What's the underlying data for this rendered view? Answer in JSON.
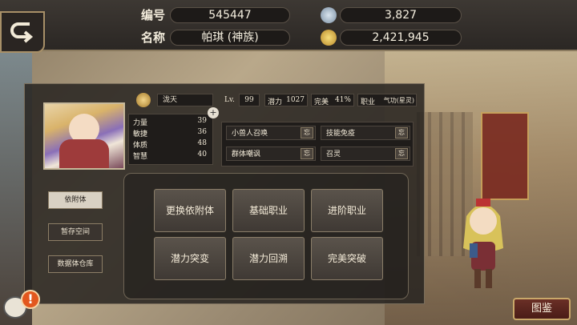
{
  "header": {
    "id_label": "编号",
    "id_value": "545447",
    "name_label": "名称",
    "name_value": "帕琪 (神族)",
    "crystal_value": "3,827",
    "gold_value": "2,421,945",
    "crystal_icon": "crystal-icon",
    "gold_icon": "gold-coin-icon"
  },
  "character": {
    "element_name": "泷天",
    "lv_label": "Lv.",
    "lv_value": "99",
    "potential_label": "潜力",
    "potential_value": "1027",
    "perfect_label": "完美",
    "perfect_value": "41%",
    "job_label": "职业",
    "job_value": "气功(星灵)"
  },
  "stats": [
    {
      "label": "力量",
      "value": "39"
    },
    {
      "label": "敏捷",
      "value": "36"
    },
    {
      "label": "体质",
      "value": "48"
    },
    {
      "label": "智慧",
      "value": "40"
    }
  ],
  "skills": [
    {
      "name": "小兽人召唤",
      "forget": "忘"
    },
    {
      "name": "技能免疫",
      "forget": "忘"
    },
    {
      "name": "群体嘲讽",
      "forget": "忘"
    },
    {
      "name": "召灵",
      "forget": "忘"
    }
  ],
  "side_menu": [
    {
      "label": "依附体",
      "active": true
    },
    {
      "label": "暂存空间",
      "active": false
    },
    {
      "label": "数据体仓库",
      "active": false
    }
  ],
  "actions": [
    "更换依附体",
    "基础职业",
    "进阶职业",
    "潜力突变",
    "潜力回溯",
    "完美突破"
  ],
  "footer": {
    "alert": "!",
    "atlas_label": "图鉴"
  },
  "colors": {
    "panel": "#28241f",
    "accent_gold": "#c9a86a",
    "alert": "#e2571e"
  }
}
